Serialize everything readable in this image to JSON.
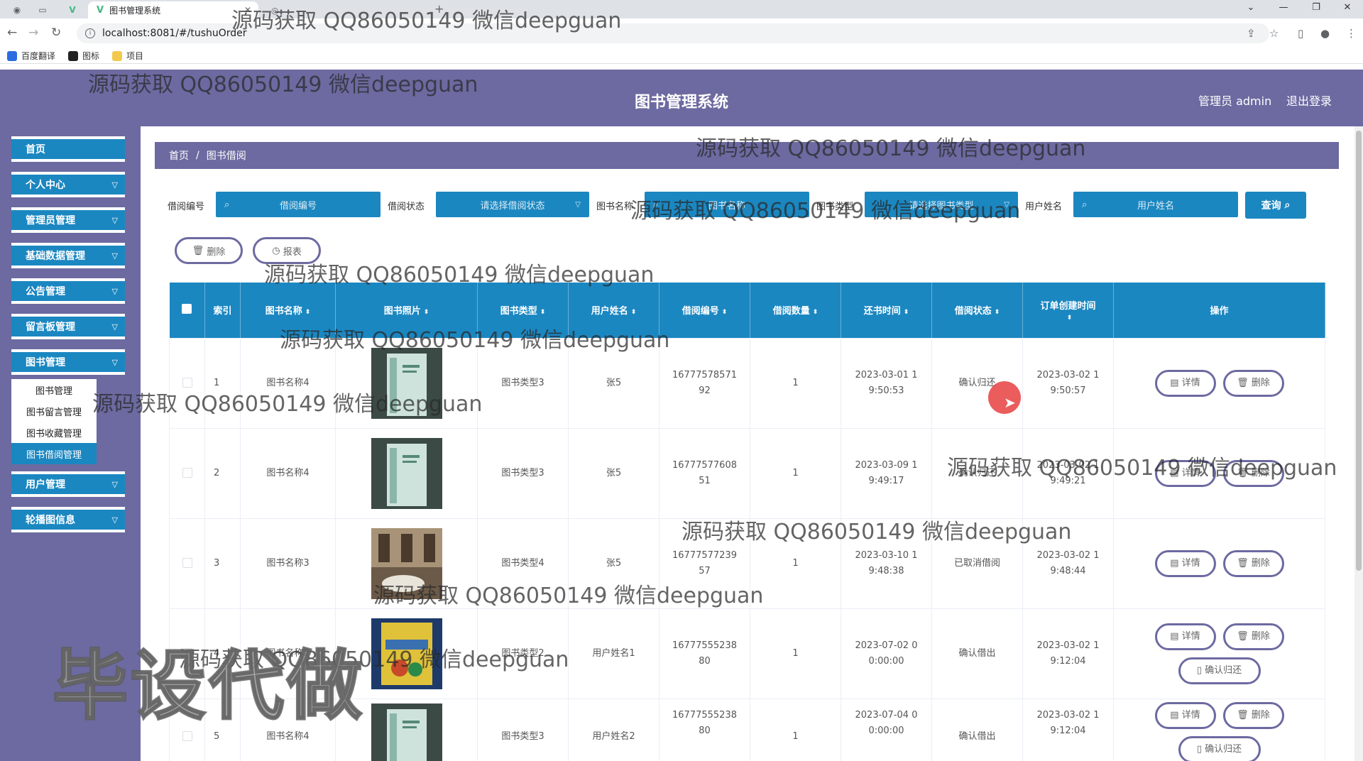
{
  "browser": {
    "tab_title": "图书管理系统",
    "url": "localhost:8081/#/tushuOrder",
    "bookmarks": [
      "百度翻译",
      "图标",
      "项目"
    ]
  },
  "header": {
    "title": "图书管理系统",
    "user": "管理员 admin",
    "logout": "退出登录"
  },
  "sidebar": {
    "items": [
      "首页",
      "个人中心",
      "管理员管理",
      "基础数据管理",
      "公告管理",
      "留言板管理",
      "图书管理",
      "用户管理",
      "轮播图信息"
    ],
    "submenu": [
      "图书管理",
      "图书留言管理",
      "图书收藏管理",
      "图书借阅管理"
    ]
  },
  "breadcrumb": {
    "home": "首页",
    "sep": "/",
    "current": "图书借阅"
  },
  "filters": {
    "borrow_no_label": "借阅编号",
    "borrow_no_placeholder": "借阅编号",
    "status_label": "借阅状态",
    "status_placeholder": "请选择借阅状态",
    "book_name_label": "图书名称",
    "book_name_placeholder": "图书名称",
    "book_type_label": "图书类型",
    "book_type_placeholder": "请选择图书类型",
    "user_label": "用户姓名",
    "user_placeholder": "用户姓名",
    "query": "查询"
  },
  "actions": {
    "delete": "删除",
    "report": "报表"
  },
  "table": {
    "columns": [
      "索引",
      "图书名称",
      "图书照片",
      "图书类型",
      "用户姓名",
      "借阅编号",
      "借阅数量",
      "还书时间",
      "借阅状态",
      "订单创建时间",
      "操作"
    ],
    "ops": {
      "detail": "详情",
      "delete": "删除",
      "confirm_return": "确认归还"
    },
    "rows": [
      {
        "idx": "1",
        "name": "图书名称4",
        "type": "图书类型3",
        "user": "张5",
        "no": "1677757857192",
        "qty": "1",
        "return": "2023-03-01 19:50:53",
        "status": "确认归还",
        "created": "2023-03-02 19:50:57"
      },
      {
        "idx": "2",
        "name": "图书名称4",
        "type": "图书类型3",
        "user": "张5",
        "no": "1677757760851",
        "qty": "1",
        "return": "2023-03-09 19:49:17",
        "status": "确认归还",
        "created": "2023-03-02 19:49:21"
      },
      {
        "idx": "3",
        "name": "图书名称3",
        "type": "图书类型4",
        "user": "张5",
        "no": "1677757723957",
        "qty": "1",
        "return": "2023-03-10 19:48:38",
        "status": "已取消借阅",
        "created": "2023-03-02 19:48:44"
      },
      {
        "idx": "4",
        "name": "图书名称2",
        "type": "图书类型2",
        "user": "用户姓名1",
        "no": "1677755523880",
        "qty": "1",
        "return": "2023-07-02 00:00:00",
        "status": "确认借出",
        "created": "2023-03-02 19:12:04"
      },
      {
        "idx": "5",
        "name": "图书名称4",
        "type": "图书类型3",
        "user": "用户姓名2",
        "no": "1677755523880",
        "qty": "1",
        "return": "2023-07-04 00:00:00",
        "status": "确认借出",
        "created": "2023-03-02 19:12:04"
      }
    ]
  },
  "watermark": "源码获取 QQ86050149 微信deepguan",
  "stamp": "毕设代做"
}
